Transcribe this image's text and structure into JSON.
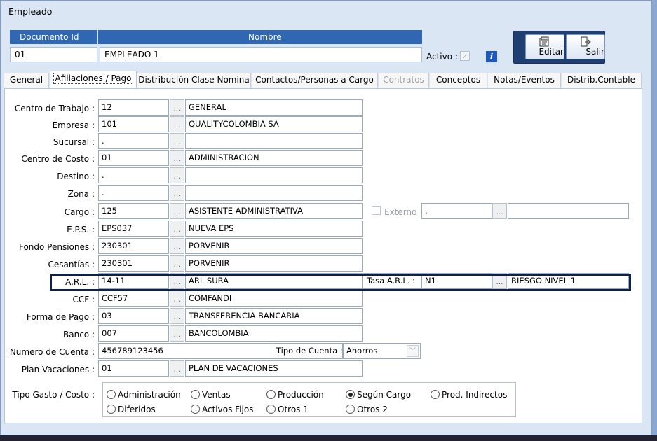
{
  "window": {
    "title": "Empleado"
  },
  "header": {
    "doc_label": "Documento Id",
    "name_label": "Nombre",
    "doc_value": "01",
    "name_value": "EMPLEADO 1",
    "activo_label": "Activo :"
  },
  "toolbar": {
    "edit_label": "Editar",
    "exit_label": "Salir"
  },
  "tabs": [
    {
      "label": "General"
    },
    {
      "label": "Afiliaciones / Pago"
    },
    {
      "label": "Distribución Clase Nomina"
    },
    {
      "label": "Contactos/Personas a Cargo"
    },
    {
      "label": "Contratos"
    },
    {
      "label": "Conceptos"
    },
    {
      "label": "Notas/Eventos"
    },
    {
      "label": "Distrib.Contable"
    }
  ],
  "rows": [
    {
      "label": "Centro de Trabajo :",
      "code": "12",
      "desc": "GENERAL"
    },
    {
      "label": "Empresa :",
      "code": "101",
      "desc": "QUALITYCOLOMBIA SA"
    },
    {
      "label": "Sucursal :",
      "code": ".",
      "desc": ""
    },
    {
      "label": "Centro de Costo :",
      "code": "01",
      "desc": "ADMINISTRACION"
    },
    {
      "label": "Destino :",
      "code": ".",
      "desc": ""
    },
    {
      "label": "Zona :",
      "code": ".",
      "desc": ""
    },
    {
      "label": "Cargo :",
      "code": "125",
      "desc": "ASISTENTE ADMINISTRATIVA"
    },
    {
      "label": "E.P.S. :",
      "code": "EPS037",
      "desc": "NUEVA EPS"
    },
    {
      "label": "Fondo Pensiones :",
      "code": "230301",
      "desc": "PORVENIR"
    },
    {
      "label": "Cesantías :",
      "code": "230301",
      "desc": "PORVENIR"
    },
    {
      "label": "A.R.L. :",
      "code": "14-11",
      "desc": "ARL SURA"
    },
    {
      "label": "CCF :",
      "code": "CCF57",
      "desc": "COMFANDI"
    },
    {
      "label": "Forma de Pago :",
      "code": "03",
      "desc": "TRANSFERENCIA BANCARIA"
    },
    {
      "label": "Banco :",
      "code": "007",
      "desc": "BANCOLOMBIA"
    }
  ],
  "externo": {
    "label": "Externo",
    "code": ".",
    "desc": ""
  },
  "tasa": {
    "label": "Tasa A.R.L. :",
    "code": "N1",
    "desc": "RIESGO NIVEL 1"
  },
  "cuenta": {
    "label": "Numero de Cuenta :",
    "value": "456789123456",
    "tipo_label": "Tipo de Cuenta :",
    "tipo_value": "Ahorros"
  },
  "vacaciones": {
    "label": "Plan Vacaciones :",
    "code": "01",
    "desc": "PLAN DE VACACIONES"
  },
  "gasto": {
    "label": "Tipo Gasto / Costo :",
    "options": [
      "Administración",
      "Ventas",
      "Producción",
      "Según Cargo",
      "Prod. Indirectos",
      "Diferidos",
      "Activos Fijos",
      "Otros 1",
      "Otros 2"
    ],
    "selected": "Según Cargo"
  }
}
